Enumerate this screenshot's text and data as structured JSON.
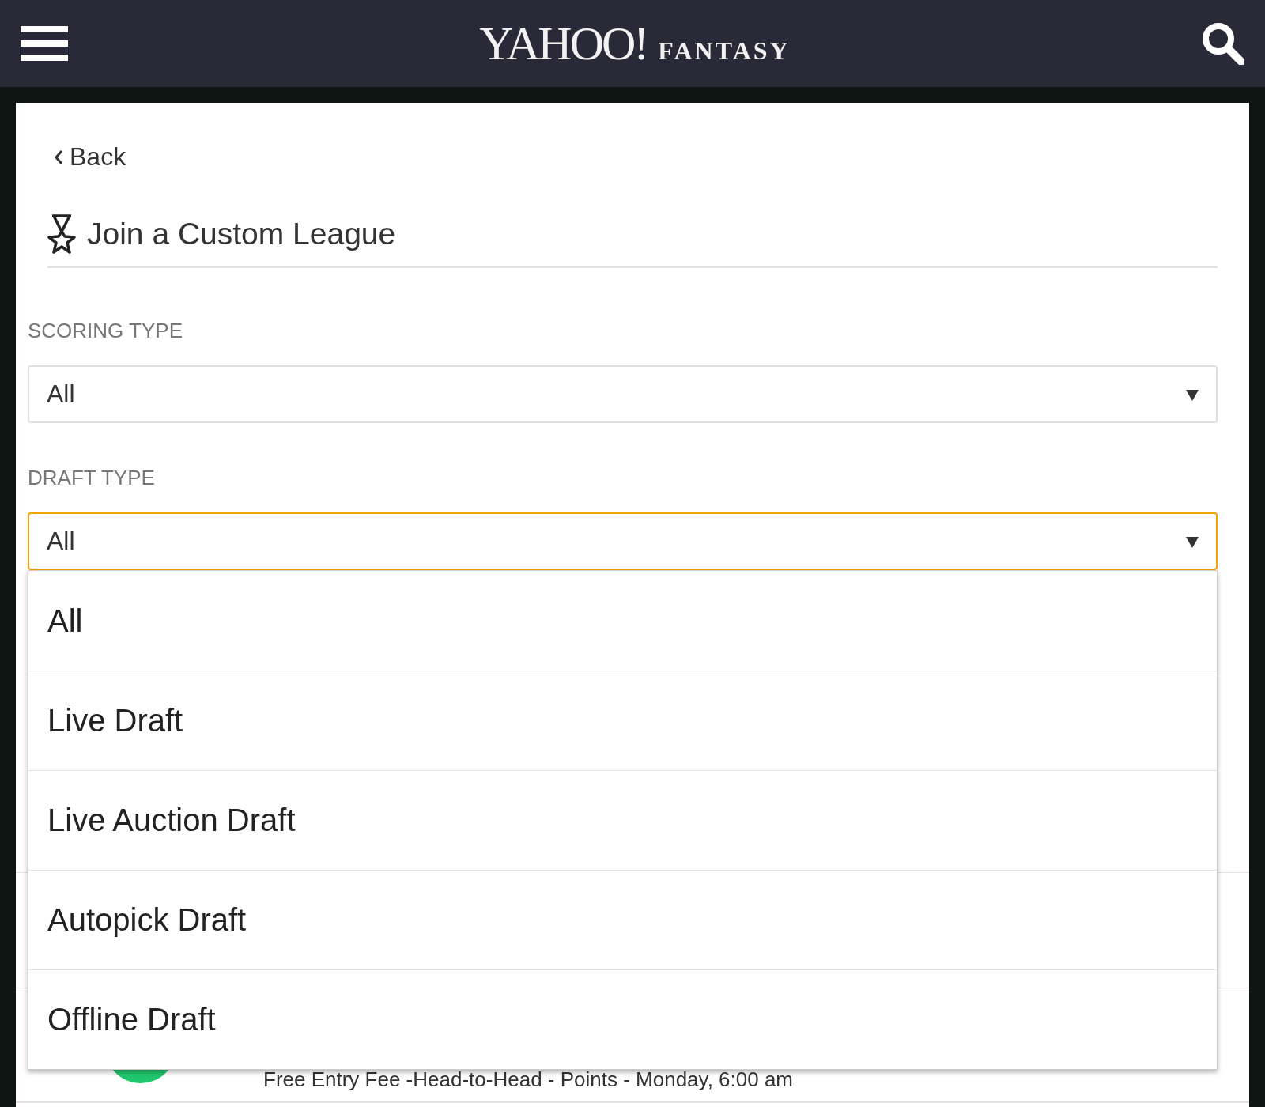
{
  "header": {
    "logo_main": "YAHOO!",
    "logo_sub": "FANTASY"
  },
  "back_link": "Back",
  "title": "Join a Custom League",
  "filters": [
    {
      "label": "SCORING TYPE",
      "value": "All",
      "focused": false
    },
    {
      "label": "DRAFT TYPE",
      "value": "All",
      "focused": true,
      "open": true,
      "options": [
        "All",
        "Live Draft",
        "Live Auction Draft",
        "Autopick Draft",
        "Offline Draft"
      ]
    }
  ],
  "leagues": [
    {
      "details": "Free Entry Fee -Head-to-Head - Points - Monday, 6:00 am"
    }
  ]
}
